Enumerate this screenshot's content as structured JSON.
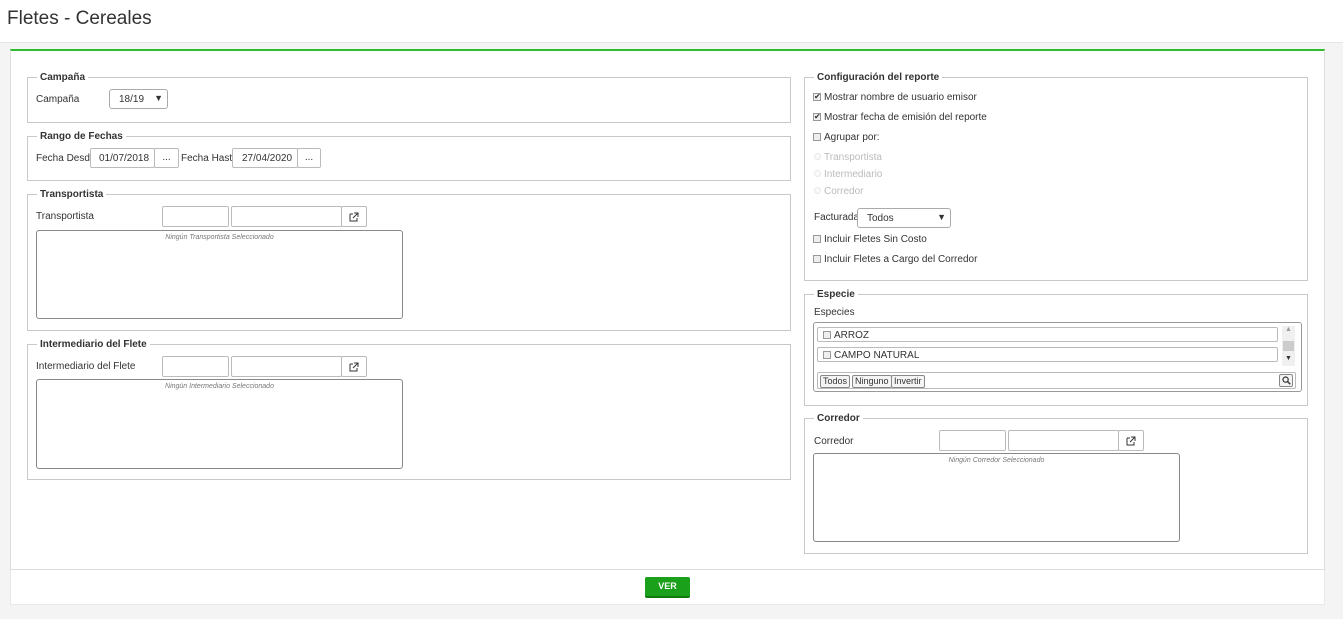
{
  "page": {
    "title": "Fletes - Cereales"
  },
  "campana": {
    "legend": "Campaña",
    "label": "Campaña",
    "value": "18/19"
  },
  "rango": {
    "legend": "Rango de Fechas",
    "desde_label": "Fecha Desde",
    "desde_value": "01/07/2018",
    "hasta_label": "Fecha Hasta",
    "hasta_value": "27/04/2020",
    "picker_label": "..."
  },
  "transportista": {
    "legend": "Transportista",
    "label": "Transportista",
    "empty": "Ningún Transportista Seleccionado"
  },
  "intermediario": {
    "legend": "Intermediario del Flete",
    "label": "Intermediario del Flete",
    "empty": "Ningún Intermediario Seleccionado"
  },
  "config": {
    "legend": "Configuración del reporte",
    "mostrar_usuario": {
      "label": "Mostrar nombre de usuario emisor",
      "checked": true
    },
    "mostrar_fecha": {
      "label": "Mostrar fecha de emisión del reporte",
      "checked": true
    },
    "agrupar": {
      "label": "Agrupar por:",
      "checked": false
    },
    "agrupar_options": [
      "Transportista",
      "Intermediario",
      "Corredor"
    ],
    "facturada_label": "Facturada",
    "facturada_value": "Todos",
    "sin_costo": {
      "label": "Incluir Fletes Sin Costo",
      "checked": false
    },
    "cargo_corredor": {
      "label": "Incluir Fletes a Cargo del Corredor",
      "checked": false
    }
  },
  "especie": {
    "legend": "Especie",
    "label": "Especies",
    "items": [
      "ARROZ",
      "CAMPO NATURAL"
    ],
    "btn_todos": "Todos",
    "btn_ninguno": "Ninguno",
    "btn_invertir": "Invertir"
  },
  "corredor": {
    "legend": "Corredor",
    "label": "Corredor",
    "empty": "Ningún Corredor Seleccionado"
  },
  "footer": {
    "ver_label": "VER"
  },
  "colors": {
    "accent": "#2ebd2e",
    "button": "#1aa01a"
  },
  "icons": {
    "external": "external-link-icon",
    "search": "search-icon"
  }
}
